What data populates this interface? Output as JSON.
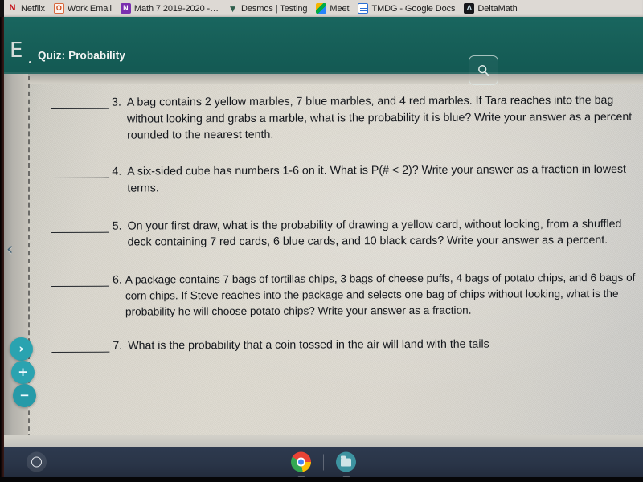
{
  "browser": {
    "bookmarks": [
      {
        "label": "Netflix",
        "icon": "netflix-icon",
        "glyph": "N"
      },
      {
        "label": "Work Email",
        "icon": "outlook-icon",
        "glyph": "O"
      },
      {
        "label": "Math 7 2019-2020 -…",
        "icon": "onenote-icon",
        "glyph": "N"
      },
      {
        "label": "Desmos | Testing",
        "icon": "desmos-icon",
        "glyph": "▼"
      },
      {
        "label": "Meet",
        "icon": "google-meet-icon",
        "glyph": ""
      },
      {
        "label": "TMDG - Google Docs",
        "icon": "google-docs-icon",
        "glyph": ""
      },
      {
        "label": "DeltaMath",
        "icon": "deltamath-icon",
        "glyph": "Δ"
      }
    ]
  },
  "header": {
    "logo": "E",
    "title": "Quiz: Probability",
    "search_icon": "search-icon",
    "background_color": "#17615a"
  },
  "worksheet": {
    "questions": [
      {
        "number": "3.",
        "text": "A bag contains 2 yellow marbles, 7 blue marbles, and 4 red marbles.  If Tara reaches into the bag without looking and grabs a marble, what is the probability it is blue? Write your answer as a percent rounded to the nearest tenth."
      },
      {
        "number": "4.",
        "text": "A six-sided cube has numbers 1-6 on it.  What is P(# < 2)? Write your answer as a fraction in lowest terms."
      },
      {
        "number": "5.",
        "text": "On your first draw, what is the probability of drawing a yellow card, without looking, from a shuffled deck containing 7 red cards, 6 blue cards, and 10 black cards? Write your answer as a percent."
      },
      {
        "number": "6.",
        "text": "A package contains 7 bags of tortillas chips, 3 bags of cheese puffs, 4 bags of potato chips, and 6 bags of corn chips. If Steve reaches into the package and selects one bag of chips without looking, what is the probability he will choose potato chips?   Write your answer as a fraction."
      },
      {
        "number": "7.",
        "text": "What is the probability that a coin tossed in the air will land with the tails"
      }
    ]
  },
  "controls": {
    "collapse_label": "‹",
    "next_label": "›",
    "zoom_in_label": "+",
    "zoom_out_label": "−",
    "accent_color": "#2aa3b0"
  },
  "shelf": {
    "launcher_name": "launcher-button",
    "apps": [
      {
        "name": "chrome-app-icon",
        "label": "Chrome"
      },
      {
        "name": "files-app-icon",
        "label": "Files"
      }
    ]
  }
}
